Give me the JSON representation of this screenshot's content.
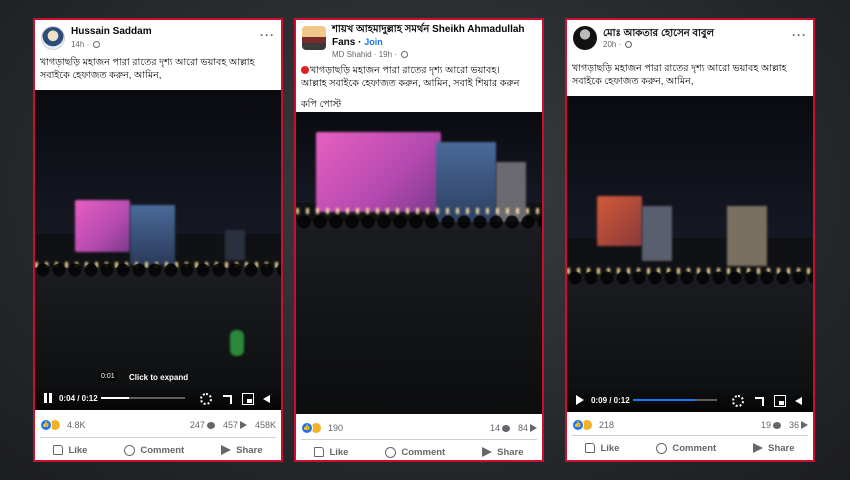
{
  "posts": [
    {
      "author": "Hussain Saddam",
      "time": "14h",
      "text": "খাগড়াছড়ি মহাজন পারা রাতের দৃশ্য আরো ভয়াবহ আল্লাহ সবাইকে হেফাজত করুন, আমিন,",
      "video": {
        "state": "paused",
        "time": "0:04 / 0:12",
        "progress": 0.33,
        "preview_time": "0:01",
        "hint": "Click to expand"
      },
      "reaction_count": "4.8K",
      "comments": "247",
      "shares": "457",
      "views": "458K",
      "actions": {
        "like": "Like",
        "comment": "Comment",
        "share": "Share"
      }
    },
    {
      "author": "শায়খ আহমাদুল্লাহ সমর্থন",
      "author_extra": "Sheikh Ahmadullah Fans",
      "join": "Join",
      "subauthor": "MD Shahid",
      "time": "19h",
      "text_line1": "খাগড়াছড়ি মহাজন পারা রাতের দৃশ্য আরো ভয়াবহ।",
      "text_line2": "আল্লাহ সবাইকে হেফাজত করুন, আমিন, সবাই শিয়ার করুন",
      "text_line3": "কপি পোস্ট",
      "reaction_count": "190",
      "comments": "14",
      "shares": "84",
      "actions": {
        "like": "Like",
        "comment": "Comment",
        "share": "Share"
      }
    },
    {
      "author": "মোঃ আকতার হোসেন বাবুল",
      "time": "20h",
      "text": "খাগড়াছড়ি মহাজন পারা রাতের দৃশ্য আরো ভয়াবহ আল্লাহ সবাইকে হেফাজত করুন, আমিন,",
      "video": {
        "state": "playing",
        "time": "0:09 / 0:12",
        "progress": 0.75
      },
      "reaction_count": "218",
      "comments": "19",
      "shares": "36",
      "actions": {
        "like": "Like",
        "comment": "Comment",
        "share": "Share"
      }
    }
  ],
  "colors": {
    "border": "#c8102e",
    "like_blue": "#1877f2",
    "muted": "#65676b"
  }
}
